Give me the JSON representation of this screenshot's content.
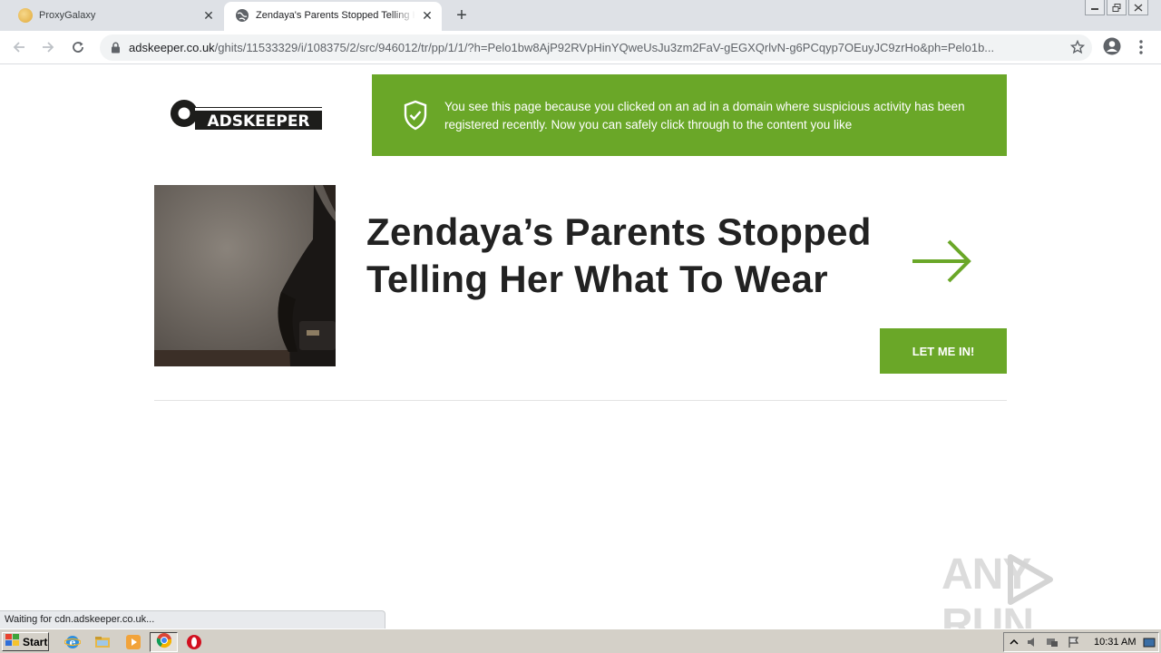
{
  "browser": {
    "tabs": [
      {
        "title": "ProxyGalaxy",
        "active": false,
        "close": "✕"
      },
      {
        "title": "Zendaya's Parents Stopped Telling Her What To Wear",
        "active": true,
        "close": "✕"
      }
    ],
    "new_tab": "+",
    "address_bar": {
      "host": "adskeeper.co.uk",
      "path": "/ghits/11533329/i/108375/2/src/946012/tr/pp/1/1/?h=Pelo1bw8AjP92RVpHinYQweUsJu3zm2FaV-gEGXQrlvN-g6PCqyp7OEuyJC9zrHo&ph=Pelo1b..."
    },
    "status_text": "Waiting for cdn.adskeeper.co.uk..."
  },
  "page": {
    "logo_text": "ADSKEEPER",
    "notice_text": "You see this page because you clicked on an ad in a domain where suspicious activity has been registered recently. Now you can safely click through to the content you like",
    "headline_line1": "Zendaya’s Parents Stopped",
    "headline_line2": "Telling Her What To Wear",
    "cta_label": "LET ME IN!",
    "brand_color": "#6aa728"
  },
  "watermark": {
    "left": "ANY",
    "right": "RUN"
  },
  "taskbar": {
    "start_label": "Start",
    "clock": "10:31 AM"
  },
  "icons": [
    "proxygalaxy-favicon",
    "globe-icon",
    "back-arrow-icon",
    "forward-arrow-icon",
    "reload-icon",
    "lock-icon",
    "star-icon",
    "profile-icon",
    "menu-dots-icon",
    "shield-check-icon",
    "arrow-right-icon",
    "ie-icon",
    "folder-icon",
    "media-player-icon",
    "chrome-icon",
    "opera-icon"
  ]
}
